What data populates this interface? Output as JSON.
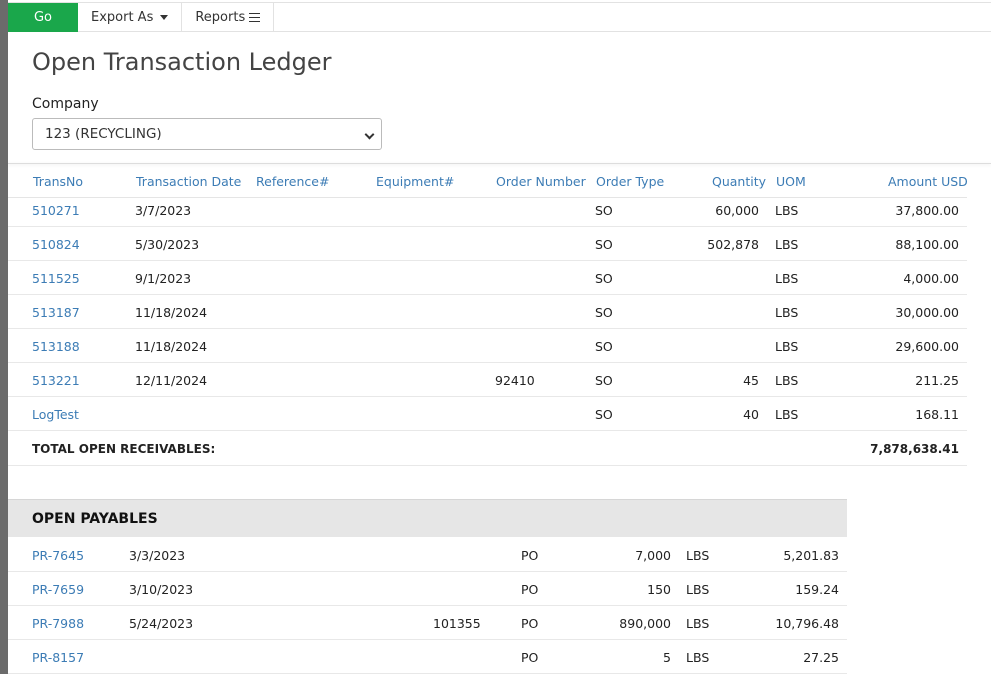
{
  "toolbar": {
    "go_label": "Go",
    "export_label": "Export As",
    "reports_label": "Reports"
  },
  "page": {
    "title": "Open Transaction Ledger",
    "company_label": "Company",
    "company_value": "123 (RECYCLING)"
  },
  "receivables": {
    "columns": [
      "TransNo",
      "Transaction Date",
      "Reference#",
      "Equipment#",
      "Order Number",
      "Order Type",
      "Quantity",
      "UOM",
      "Amount USD"
    ],
    "rows": [
      {
        "trans": "510271",
        "date": "3/7/2023",
        "ref": "",
        "equip": "",
        "order": "",
        "type": "SO",
        "qty": "60,000",
        "uom": "LBS",
        "amount": "37,800.00"
      },
      {
        "trans": "510824",
        "date": "5/30/2023",
        "ref": "",
        "equip": "",
        "order": "",
        "type": "SO",
        "qty": "502,878",
        "uom": "LBS",
        "amount": "88,100.00"
      },
      {
        "trans": "511525",
        "date": "9/1/2023",
        "ref": "",
        "equip": "",
        "order": "",
        "type": "SO",
        "qty": "",
        "uom": "LBS",
        "amount": "4,000.00"
      },
      {
        "trans": "513187",
        "date": "11/18/2024",
        "ref": "",
        "equip": "",
        "order": "",
        "type": "SO",
        "qty": "",
        "uom": "LBS",
        "amount": "30,000.00"
      },
      {
        "trans": "513188",
        "date": "11/18/2024",
        "ref": "",
        "equip": "",
        "order": "",
        "type": "SO",
        "qty": "",
        "uom": "LBS",
        "amount": "29,600.00"
      },
      {
        "trans": "513221",
        "date": "12/11/2024",
        "ref": "",
        "equip": "",
        "order": "92410",
        "type": "SO",
        "qty": "45",
        "uom": "LBS",
        "amount": "211.25"
      },
      {
        "trans": "LogTest",
        "date": "",
        "ref": "",
        "equip": "",
        "order": "",
        "type": "SO",
        "qty": "40",
        "uom": "LBS",
        "amount": "168.11"
      }
    ],
    "total_label": "TOTAL OPEN RECEIVABLES:",
    "total_value": "7,878,638.41"
  },
  "payables": {
    "title": "OPEN PAYABLES",
    "rows": [
      {
        "trans": "PR-7645",
        "date": "3/3/2023",
        "order": "",
        "type": "PO",
        "qty": "7,000",
        "uom": "LBS",
        "amount": "5,201.83"
      },
      {
        "trans": "PR-7659",
        "date": "3/10/2023",
        "order": "",
        "type": "PO",
        "qty": "150",
        "uom": "LBS",
        "amount": "159.24"
      },
      {
        "trans": "PR-7988",
        "date": "5/24/2023",
        "order": "101355",
        "type": "PO",
        "qty": "890,000",
        "uom": "LBS",
        "amount": "10,796.48"
      },
      {
        "trans": "PR-8157",
        "date": "",
        "order": "",
        "type": "PO",
        "qty": "5",
        "uom": "LBS",
        "amount": "27.25"
      }
    ]
  }
}
